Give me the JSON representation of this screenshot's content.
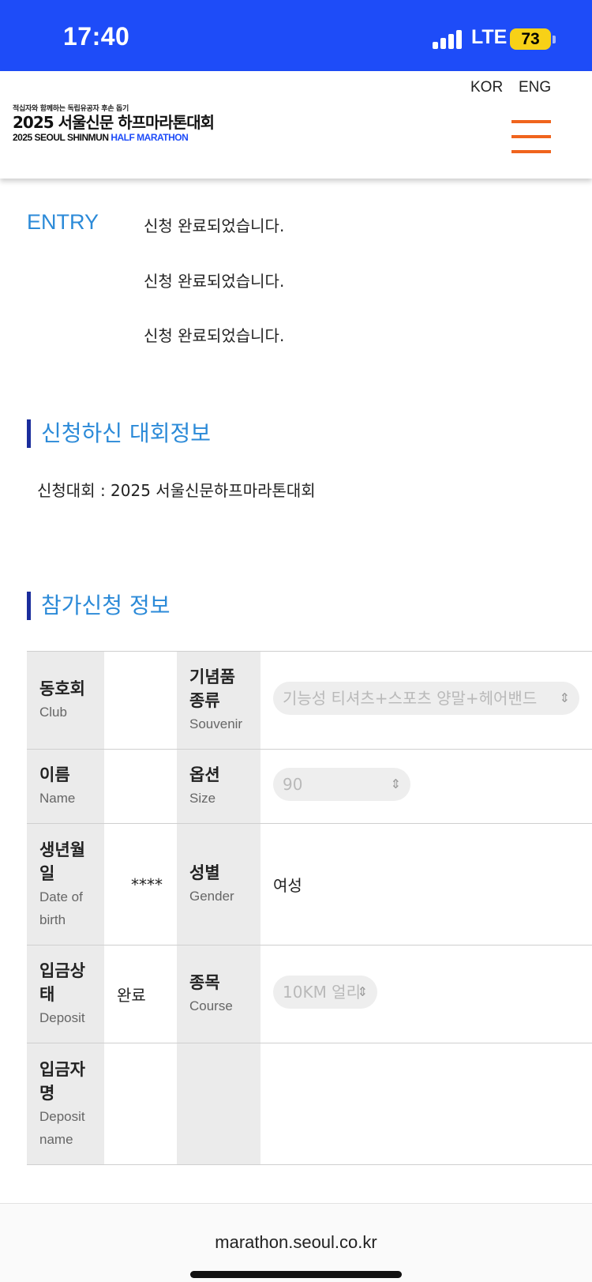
{
  "status_bar": {
    "time": "17:40",
    "network": "LTE",
    "battery": "73"
  },
  "header": {
    "logo_sub": "적십자와 함께하는 독립유공자 후손 돕기",
    "logo_main": "2025 서울신문 하프마라톤대회",
    "logo_en_prefix": "2025 SEOUL SHINMUN ",
    "logo_en_accent": "HALF MARATHON",
    "lang_kor": "KOR",
    "lang_eng": "ENG"
  },
  "entry": {
    "label": "ENTRY",
    "messages": [
      "신청 완료되었습니다.",
      "신청 완료되었습니다.",
      "신청 완료되었습니다."
    ]
  },
  "event_section": {
    "title": "신청하신 대회정보",
    "event_line": "신청대회 : 2025 서울신문하프마라톤대회"
  },
  "participant_section": {
    "title": "참가신청 정보",
    "club": {
      "label_ko": "동호회",
      "label_en": "Club",
      "value": ""
    },
    "souvenir": {
      "label_ko_1": "기념품",
      "label_ko_2": "종류",
      "label_en": "Souvenir",
      "value": "기능성 티셔츠+스포츠 양말+헤어밴드"
    },
    "name": {
      "label_ko": "이름",
      "label_en": "Name",
      "value": ""
    },
    "size": {
      "label_ko": "옵션",
      "label_en": "Size",
      "value": "90"
    },
    "dob": {
      "label_ko_1": "생년월",
      "label_ko_2": "일",
      "label_en_1": "Date of",
      "label_en_2": "birth",
      "value": "****"
    },
    "gender": {
      "label_ko": "성별",
      "label_en": "Gender",
      "value": "여성"
    },
    "deposit": {
      "label_ko_1": "입금상",
      "label_ko_2": "태",
      "label_en": "Deposit",
      "value": "완료"
    },
    "course": {
      "label_ko": "종목",
      "label_en": "Course",
      "value": "10KM 얼리"
    },
    "depositor": {
      "label_ko_1": "입금자",
      "label_ko_2": "명",
      "label_en_1": "Deposit",
      "label_en_2": "name",
      "value": ""
    }
  },
  "url_bar": {
    "url": "marathon.seoul.co.kr"
  },
  "colors": {
    "status_bar_bg": "#1e4cf8",
    "accent_blue": "#2b8ad8",
    "section_bar": "#1a2d9c",
    "menu_orange": "#f0641d",
    "battery_yellow": "#f7d117",
    "table_header_bg": "#ebebeb"
  }
}
